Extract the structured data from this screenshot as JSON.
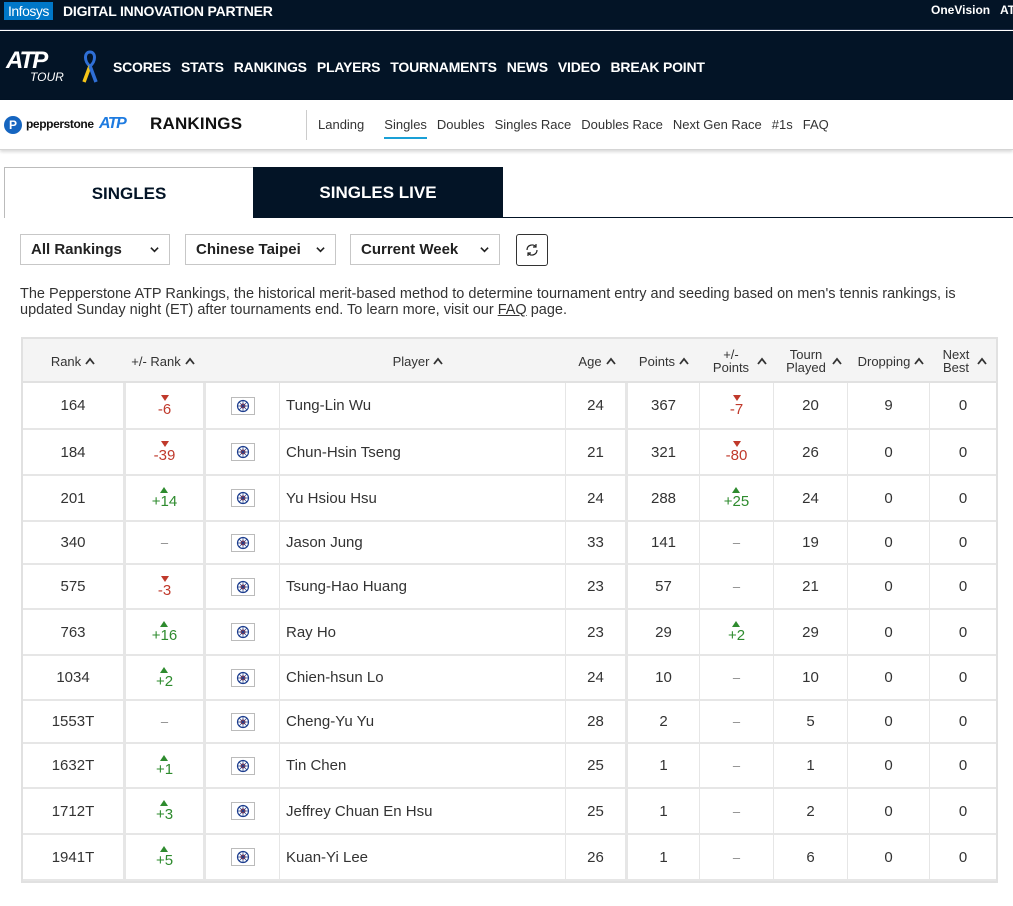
{
  "partner_bar": {
    "infosys": "Infosys",
    "tagline": "DIGITAL INNOVATION PARTNER",
    "onevision": "OneVision",
    "truncated": "AT"
  },
  "nav": {
    "logo_atp": "ATP",
    "logo_tour": "TOUR",
    "links": [
      "SCORES",
      "STATS",
      "RANKINGS",
      "PLAYERS",
      "TOURNAMENTS",
      "NEWS",
      "VIDEO",
      "BREAK POINT"
    ]
  },
  "rankings_header": {
    "sponsor": "pepperstone",
    "atp": "ATP",
    "title": "RANKINGS",
    "links": [
      "Landing",
      "Singles",
      "Doubles",
      "Singles Race",
      "Doubles Race",
      "Next Gen Race",
      "#1s",
      "FAQ"
    ],
    "active": "Singles"
  },
  "tabs": {
    "singles": "SINGLES",
    "live": "SINGLES LIVE"
  },
  "filters": {
    "rankings": "All Rankings",
    "country": "Chinese Taipei",
    "week": "Current Week"
  },
  "intro": {
    "text": "The Pepperstone ATP Rankings, the historical merit-based method to determine tournament entry and seeding based on men's tennis rankings, is updated Sunday night (ET) after tournaments end. To learn more, visit our ",
    "link": "FAQ",
    "suffix": " page."
  },
  "columns": {
    "rank": "Rank",
    "rank_move": "+/- Rank",
    "player": "Player",
    "age": "Age",
    "points": "Points",
    "points_move_1": "+/-",
    "points_move_2": "Points",
    "played_1": "Tourn",
    "played_2": "Played",
    "dropping": "Dropping",
    "next_1": "Next",
    "next_2": "Best"
  },
  "rows": [
    {
      "rank": "164",
      "rank_move": {
        "dir": "down",
        "val": "-6"
      },
      "player": "Tung-Lin Wu",
      "age": "24",
      "points": "367",
      "points_move": {
        "dir": "down",
        "val": "-7"
      },
      "played": "20",
      "dropping": "9",
      "next_best": "0"
    },
    {
      "rank": "184",
      "rank_move": {
        "dir": "down",
        "val": "-39"
      },
      "player": "Chun-Hsin Tseng",
      "age": "21",
      "points": "321",
      "points_move": {
        "dir": "down",
        "val": "-80"
      },
      "played": "26",
      "dropping": "0",
      "next_best": "0"
    },
    {
      "rank": "201",
      "rank_move": {
        "dir": "up",
        "val": "+14"
      },
      "player": "Yu Hsiou Hsu",
      "age": "24",
      "points": "288",
      "points_move": {
        "dir": "up",
        "val": "+25"
      },
      "played": "24",
      "dropping": "0",
      "next_best": "0"
    },
    {
      "rank": "340",
      "rank_move": {
        "dir": "none",
        "val": "–"
      },
      "player": "Jason Jung",
      "age": "33",
      "points": "141",
      "points_move": {
        "dir": "none",
        "val": "–"
      },
      "played": "19",
      "dropping": "0",
      "next_best": "0"
    },
    {
      "rank": "575",
      "rank_move": {
        "dir": "down",
        "val": "-3"
      },
      "player": "Tsung-Hao Huang",
      "age": "23",
      "points": "57",
      "points_move": {
        "dir": "none",
        "val": "–"
      },
      "played": "21",
      "dropping": "0",
      "next_best": "0"
    },
    {
      "rank": "763",
      "rank_move": {
        "dir": "up",
        "val": "+16"
      },
      "player": "Ray Ho",
      "age": "23",
      "points": "29",
      "points_move": {
        "dir": "up",
        "val": "+2"
      },
      "played": "29",
      "dropping": "0",
      "next_best": "0"
    },
    {
      "rank": "1034",
      "rank_move": {
        "dir": "up",
        "val": "+2"
      },
      "player": "Chien-hsun Lo",
      "age": "24",
      "points": "10",
      "points_move": {
        "dir": "none",
        "val": "–"
      },
      "played": "10",
      "dropping": "0",
      "next_best": "0"
    },
    {
      "rank": "1553T",
      "rank_move": {
        "dir": "none",
        "val": "–"
      },
      "player": "Cheng-Yu Yu",
      "age": "28",
      "points": "2",
      "points_move": {
        "dir": "none",
        "val": "–"
      },
      "played": "5",
      "dropping": "0",
      "next_best": "0"
    },
    {
      "rank": "1632T",
      "rank_move": {
        "dir": "up",
        "val": "+1"
      },
      "player": "Tin Chen",
      "age": "25",
      "points": "1",
      "points_move": {
        "dir": "none",
        "val": "–"
      },
      "played": "1",
      "dropping": "0",
      "next_best": "0"
    },
    {
      "rank": "1712T",
      "rank_move": {
        "dir": "up",
        "val": "+3"
      },
      "player": "Jeffrey Chuan En Hsu",
      "age": "25",
      "points": "1",
      "points_move": {
        "dir": "none",
        "val": "–"
      },
      "played": "2",
      "dropping": "0",
      "next_best": "0"
    },
    {
      "rank": "1941T",
      "rank_move": {
        "dir": "up",
        "val": "+5"
      },
      "player": "Kuan-Yi Lee",
      "age": "26",
      "points": "1",
      "points_move": {
        "dir": "none",
        "val": "–"
      },
      "played": "6",
      "dropping": "0",
      "next_best": "0"
    }
  ],
  "colors": {
    "navy": "#031426",
    "up": "#2e8b2e",
    "down": "#c0392b",
    "accent": "#1aa0d6"
  }
}
